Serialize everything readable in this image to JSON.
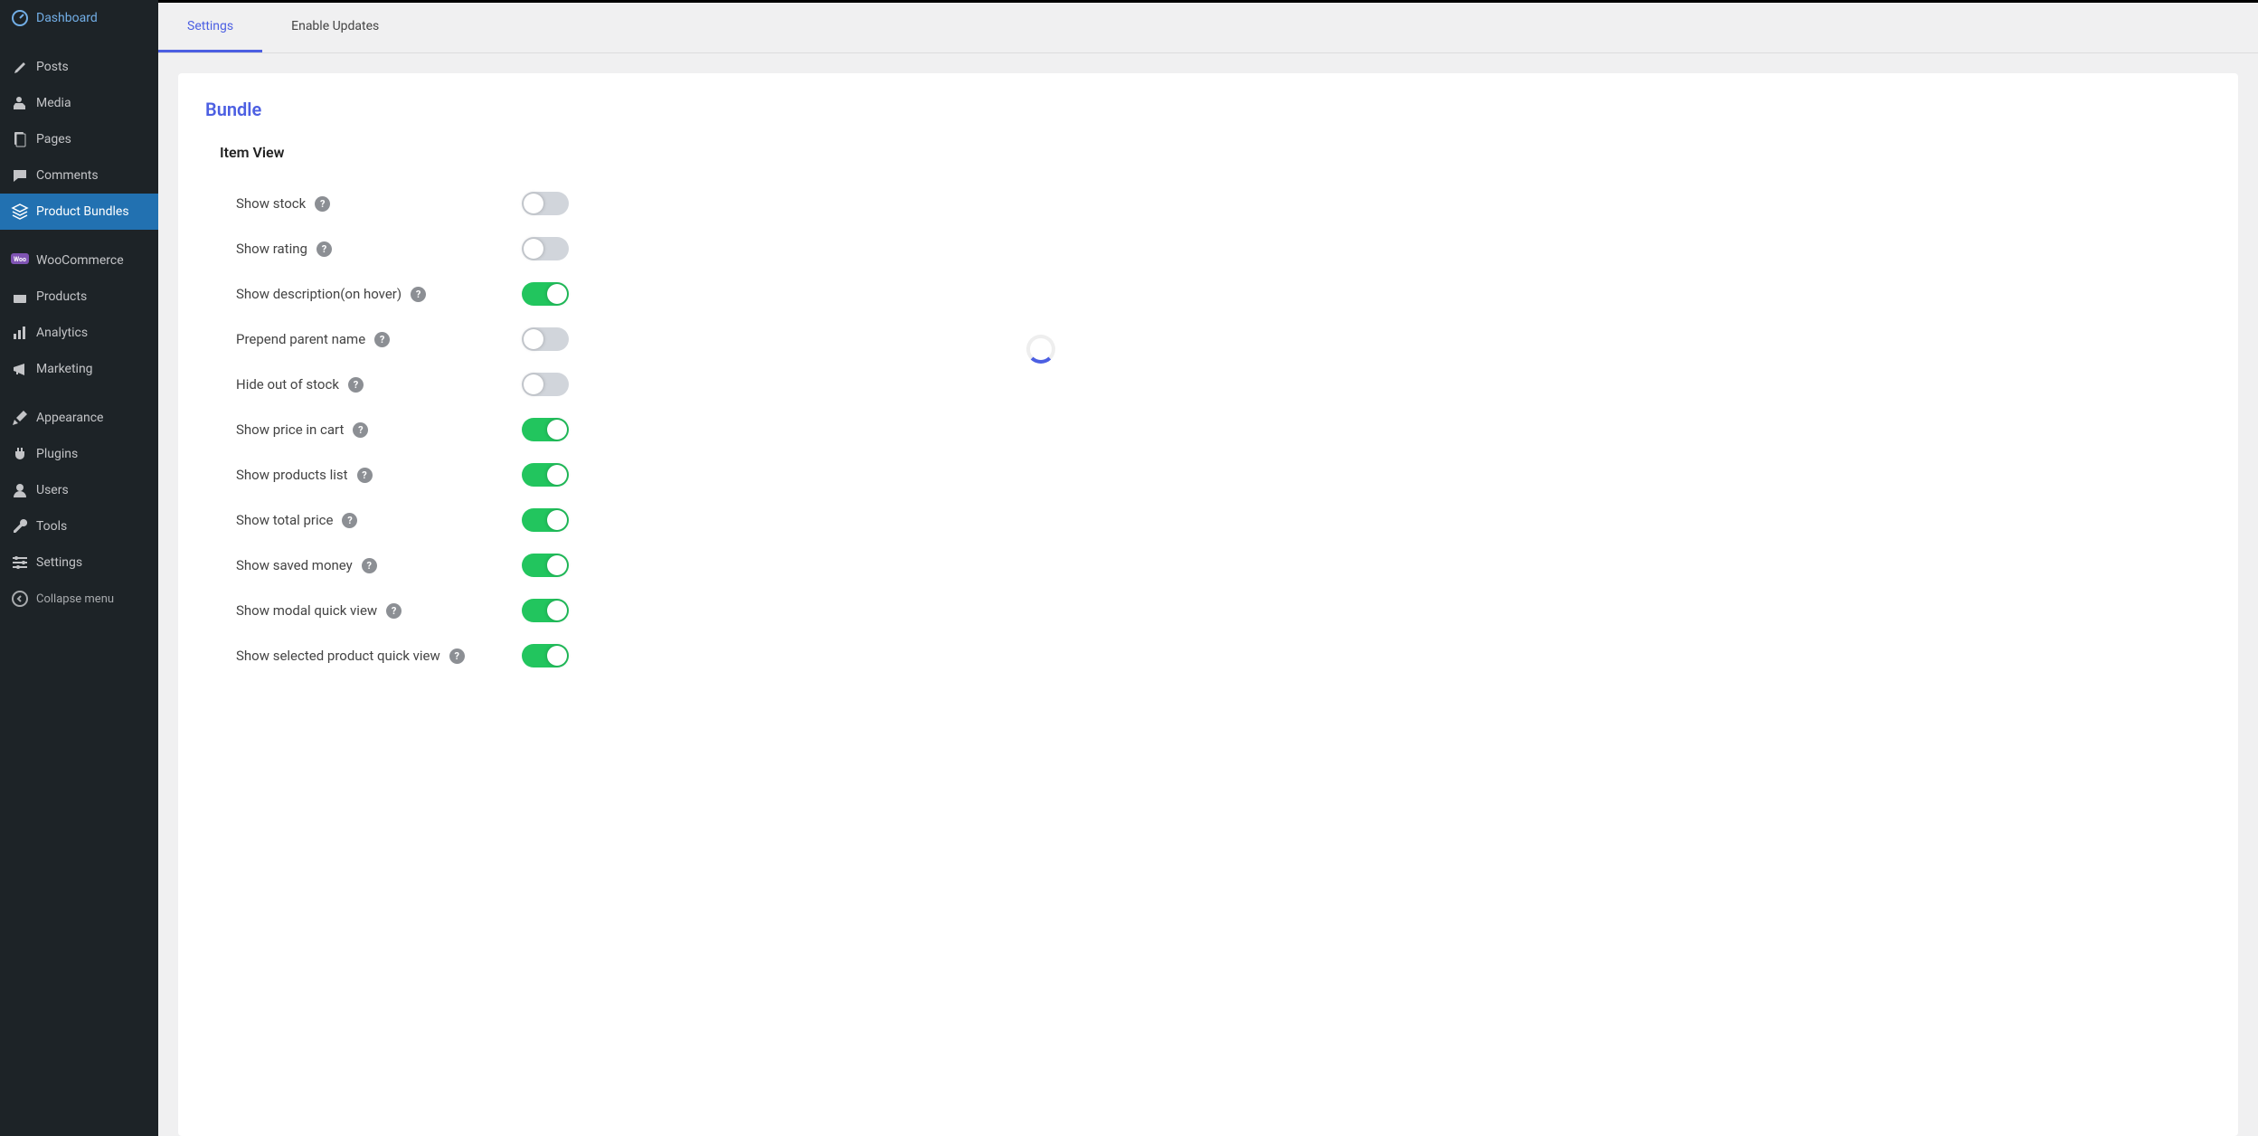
{
  "sidebar": {
    "items": [
      {
        "label": "Dashboard",
        "icon": "dashboard"
      },
      {
        "label": "Posts",
        "icon": "pin"
      },
      {
        "label": "Media",
        "icon": "media"
      },
      {
        "label": "Pages",
        "icon": "page"
      },
      {
        "label": "Comments",
        "icon": "comments"
      },
      {
        "label": "Product Bundles",
        "icon": "layers",
        "active": true
      },
      {
        "label": "WooCommerce",
        "icon": "woo"
      },
      {
        "label": "Products",
        "icon": "box"
      },
      {
        "label": "Analytics",
        "icon": "chart"
      },
      {
        "label": "Marketing",
        "icon": "megaphone"
      },
      {
        "label": "Appearance",
        "icon": "brush"
      },
      {
        "label": "Plugins",
        "icon": "plug"
      },
      {
        "label": "Users",
        "icon": "user"
      },
      {
        "label": "Tools",
        "icon": "wrench"
      },
      {
        "label": "Settings",
        "icon": "sliders"
      }
    ],
    "collapse_label": "Collapse menu"
  },
  "tabs": [
    {
      "label": "Settings",
      "active": true
    },
    {
      "label": "Enable Updates",
      "active": false
    }
  ],
  "panel": {
    "title": "Bundle",
    "section": "Item View",
    "settings": [
      {
        "label": "Show stock",
        "on": false
      },
      {
        "label": "Show rating",
        "on": false
      },
      {
        "label": "Show description(on hover)",
        "on": true
      },
      {
        "label": "Prepend parent name",
        "on": false
      },
      {
        "label": "Hide out of stock",
        "on": false
      },
      {
        "label": "Show price in cart",
        "on": true
      },
      {
        "label": "Show products list",
        "on": true
      },
      {
        "label": "Show total price",
        "on": true
      },
      {
        "label": "Show saved money",
        "on": true
      },
      {
        "label": "Show modal quick view",
        "on": true
      },
      {
        "label": "Show selected product quick view",
        "on": true
      }
    ]
  }
}
